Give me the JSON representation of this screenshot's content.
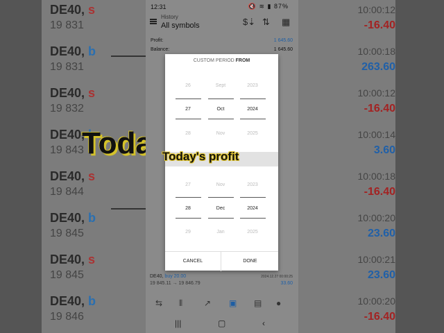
{
  "status_bar": {
    "time": "12:31",
    "battery": "87%"
  },
  "app_bar": {
    "subtitle": "History",
    "title": "All symbols"
  },
  "summary": {
    "profit_label": "Profit:",
    "profit_value": "1 645.60",
    "balance_label": "Balance:",
    "balance_value": "1 645.60"
  },
  "dialog": {
    "title_prefix": "CUSTOM PERIOD ",
    "title_strong": "FROM",
    "from": {
      "prev": {
        "day": "26",
        "month": "Sept",
        "year": "2023"
      },
      "selected": {
        "day": "27",
        "month": "Oct",
        "year": "2024"
      },
      "next": {
        "day": "28",
        "month": "Nov",
        "year": "2025"
      }
    },
    "to": {
      "prev": {
        "day": "27",
        "month": "Nov",
        "year": "2023"
      },
      "selected": {
        "day": "28",
        "month": "Dec",
        "year": "2024"
      },
      "next": {
        "day": "29",
        "month": "Jan",
        "year": "2025"
      }
    },
    "cancel_label": "CANCEL",
    "done_label": "DONE"
  },
  "overlay_caption": "Today's profit",
  "background_caption": "Toda",
  "trades": [
    {
      "symbol": "DE40,",
      "side": "buy 20.00",
      "prices": "19 845.11 → 19 846.79",
      "date": "2024.12.27 00:00:25",
      "profit": "33.60",
      "type": "pos"
    }
  ],
  "bg_left_rows": [
    {
      "symbol": "DE40,",
      "side": "s",
      "price": "19 831"
    },
    {
      "symbol": "DE40,",
      "side": "b",
      "price": "19 831"
    },
    {
      "symbol": "DE40,",
      "side": "s",
      "price": "19 832"
    },
    {
      "symbol": "DE40,",
      "side": "b",
      "price": "19 843"
    },
    {
      "symbol": "DE40,",
      "side": "s",
      "price": "19 844"
    },
    {
      "symbol": "DE40,",
      "side": "b",
      "price": "19 845"
    },
    {
      "symbol": "DE40,",
      "side": "s",
      "price": "19 845"
    },
    {
      "symbol": "DE40,",
      "side": "b",
      "price": "19 846"
    }
  ],
  "bg_right_rows": [
    {
      "time": "10:00:12",
      "profit": "-16.40",
      "type": "neg"
    },
    {
      "time": "10:00:18",
      "profit": "263.60",
      "type": "pos"
    },
    {
      "time": "10:00:12",
      "profit": "-16.40",
      "type": "neg"
    },
    {
      "time": "10:00:14",
      "profit": "3.60",
      "type": "pos"
    },
    {
      "time": "10:00:18",
      "profit": "-16.40",
      "type": "neg"
    },
    {
      "time": "10:00:20",
      "profit": "23.60",
      "type": "pos"
    },
    {
      "time": "10:00:21",
      "profit": "23.60",
      "type": "pos"
    },
    {
      "time": "10:00:20",
      "profit": "-16.40",
      "type": "neg"
    }
  ],
  "colors": {
    "accent_blue": "#1d5ea4",
    "loss_red": "#b22222",
    "caption_yellow": "#e2c52e"
  }
}
